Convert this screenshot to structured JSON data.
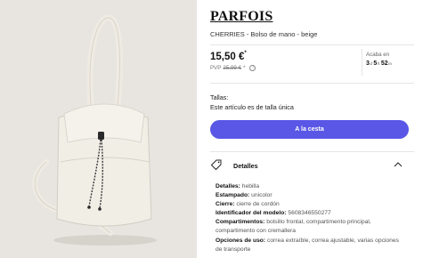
{
  "product": {
    "brand": "PARFOIS",
    "subtitle": "CHERRIES - Bolso de mano - beige",
    "price": "15,50 €",
    "price_note": "*",
    "pvp_label": "PVP",
    "pvp_old": "25,99 €",
    "pvp_note": "*",
    "info_icon": "info-icon",
    "image_alt": "handbag-image"
  },
  "countdown": {
    "label": "Acaba en",
    "days": "3",
    "days_unit": "d",
    "hours": "5",
    "hours_unit": "h",
    "minutes": "52",
    "minutes_unit": "m"
  },
  "size": {
    "label": "Tallas:",
    "value": "Este artículo es de talla única"
  },
  "cart_button": {
    "label": "A la cesta"
  },
  "details": {
    "title": "Detalles",
    "icon": "tag-icon",
    "expand_icon": "chevron-up-icon",
    "rows": [
      {
        "key": "Detalles:",
        "value": "hebilla"
      },
      {
        "key": "Estampado:",
        "value": "unicolor"
      },
      {
        "key": "Cierre:",
        "value": "cierre de cordón"
      },
      {
        "key": "Identificador del modelo:",
        "value": "5608346550277"
      },
      {
        "key": "Compartimentos:",
        "value": "bolsillo frontal, compartimento principal, compartimento con cremallera"
      },
      {
        "key": "Opciones de uso:",
        "value": "correa extraíble, correa ajustable, varias opciones de transporte"
      }
    ]
  },
  "colors": {
    "accent": "#5a57e6",
    "image_bg": "#e8e5e1",
    "bag": "#f1eee6"
  }
}
